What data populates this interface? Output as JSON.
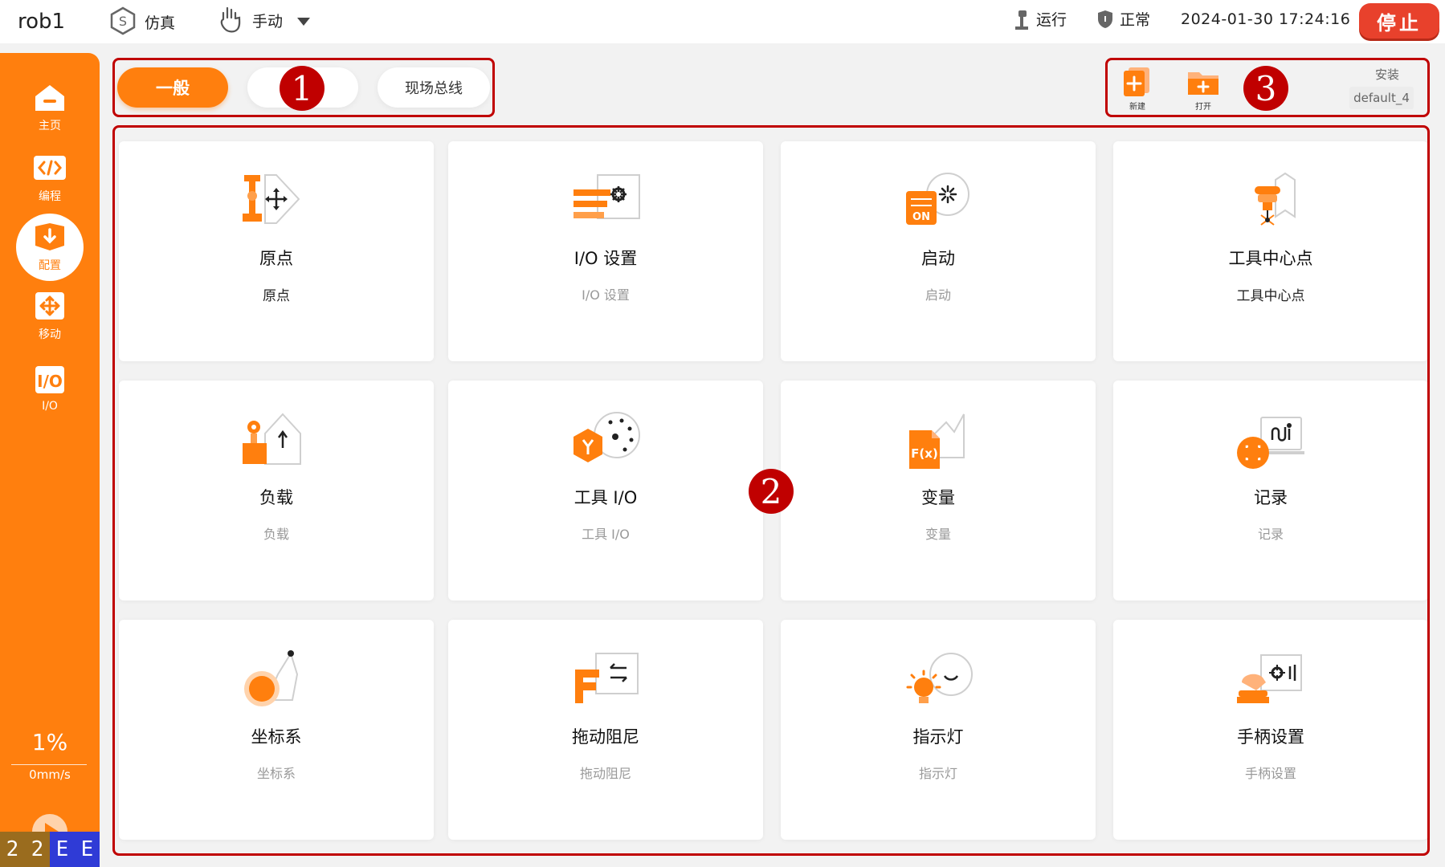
{
  "topbar": {
    "robot_name": "rob1",
    "sim_icon": "sim-badge-icon",
    "sim_label": "仿真",
    "manual_icon": "hand-icon",
    "manual_label": "手动",
    "run_label": "运行",
    "normal_label": "正常",
    "datetime": "2024-01-30 17:24:16",
    "stop_label": "停止"
  },
  "sidebar": {
    "items": [
      {
        "label": "主页",
        "icon": "home-icon"
      },
      {
        "label": "编程",
        "icon": "code-icon"
      },
      {
        "label": "配置",
        "icon": "config-icon",
        "active": true
      },
      {
        "label": "移动",
        "icon": "move-icon"
      },
      {
        "label": "I/O",
        "icon": "io-icon"
      }
    ],
    "speed_percent": "1%",
    "speed_mm": "0mm/s",
    "codes": [
      "2",
      "2",
      "E",
      "E"
    ]
  },
  "tabs": {
    "general": "一般",
    "blank": "",
    "fieldbus": "现场总线"
  },
  "actions": {
    "new_label": "新建",
    "open_label": "打开",
    "install_label": "安装",
    "install_value": "default_4"
  },
  "markers": [
    "1",
    "2",
    "3"
  ],
  "cards": [
    {
      "title": "原点",
      "subtitle": "原点",
      "icon": "origin-icon"
    },
    {
      "title": "I/O 设置",
      "subtitle": "I/O 设置",
      "icon": "io-settings-icon"
    },
    {
      "title": "启动",
      "subtitle": "启动",
      "icon": "startup-icon"
    },
    {
      "title": "工具中心点",
      "subtitle": "工具中心点",
      "icon": "tcp-icon"
    },
    {
      "title": "负载",
      "subtitle": "负载",
      "icon": "payload-icon"
    },
    {
      "title": "工具 I/O",
      "subtitle": "工具 I/O",
      "icon": "tool-io-icon"
    },
    {
      "title": "变量",
      "subtitle": "变量",
      "icon": "variable-icon"
    },
    {
      "title": "记录",
      "subtitle": "记录",
      "icon": "log-icon"
    },
    {
      "title": "坐标系",
      "subtitle": "坐标系",
      "icon": "coordinate-icon"
    },
    {
      "title": "拖动阻尼",
      "subtitle": "拖动阻尼",
      "icon": "drag-damping-icon"
    },
    {
      "title": "指示灯",
      "subtitle": "指示灯",
      "icon": "indicator-light-icon"
    },
    {
      "title": "手柄设置",
      "subtitle": "手柄设置",
      "icon": "handle-settings-icon"
    }
  ],
  "colors": {
    "accent": "#ff7f0e",
    "stop": "#e8412c",
    "annotation": "#c00000"
  }
}
